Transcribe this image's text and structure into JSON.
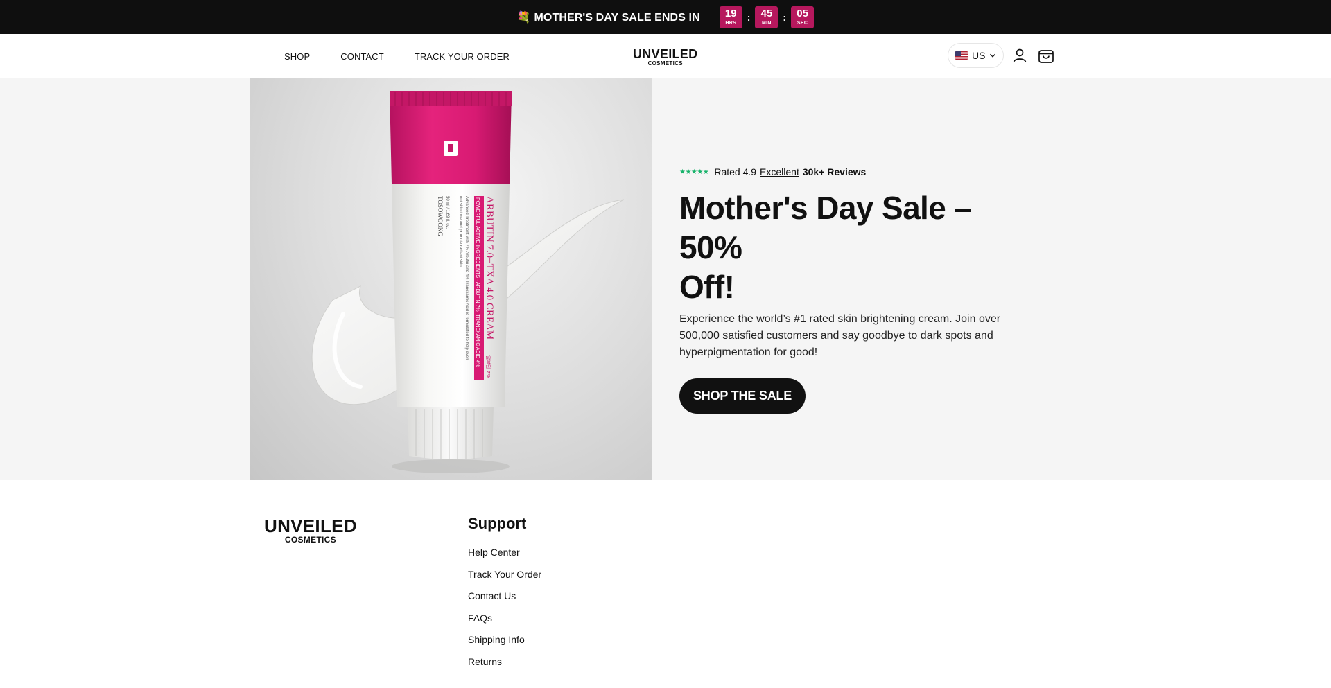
{
  "announcement": {
    "emoji": "💐",
    "text": "MOTHER'S DAY SALE ENDS IN",
    "timer": [
      {
        "value": "19",
        "label": "HRS"
      },
      {
        "value": "45",
        "label": "MIN"
      },
      {
        "value": "05",
        "label": "SEC"
      }
    ],
    "separator": ":"
  },
  "nav": {
    "items": [
      "SHOP",
      "CONTACT",
      "TRACK YOUR ORDER"
    ]
  },
  "brand": {
    "line1": "UNVEILED",
    "line2": "COSMETICS"
  },
  "header_right": {
    "country": "US",
    "icons": [
      "chevron-down-icon",
      "account-icon",
      "cart-icon"
    ]
  },
  "hero": {
    "rating": {
      "stars": "★★★★★",
      "rated": "Rated 4.9",
      "excellent": "Excellent",
      "reviews": "30k+ Reviews"
    },
    "title_line1": "Mother's Day Sale – 50%",
    "title_line2": "Off!",
    "description": "Experience the world’s #1 rated skin brightening cream. Join over 500,000 satisfied customers and say goodbye to dark spots and hyperpigmentation for good!",
    "cta": "SHOP THE SALE",
    "product": {
      "name": "ARBUTIN 7.0+TXA 4.0 CREAM",
      "korean": "알부틴 7%",
      "band": "POWERFUL ACTIVE INGREDIENTS - ARBUTIN 7%, TRANEXAMIC ACID 4%",
      "desc_line1": "Advanced Treatment with 7% Arbutin and 4% Tranexamic Acid is formulated to help even",
      "desc_line2": "out skin tone and promote radiant skin",
      "volume": "50 ml / 1.69 fl. oz.",
      "maker": "TOSOWOONG"
    }
  },
  "footer": {
    "support_title": "Support",
    "links": [
      "Help Center",
      "Track Your Order",
      "Contact Us",
      "FAQs",
      "Shipping Info",
      "Returns"
    ]
  }
}
